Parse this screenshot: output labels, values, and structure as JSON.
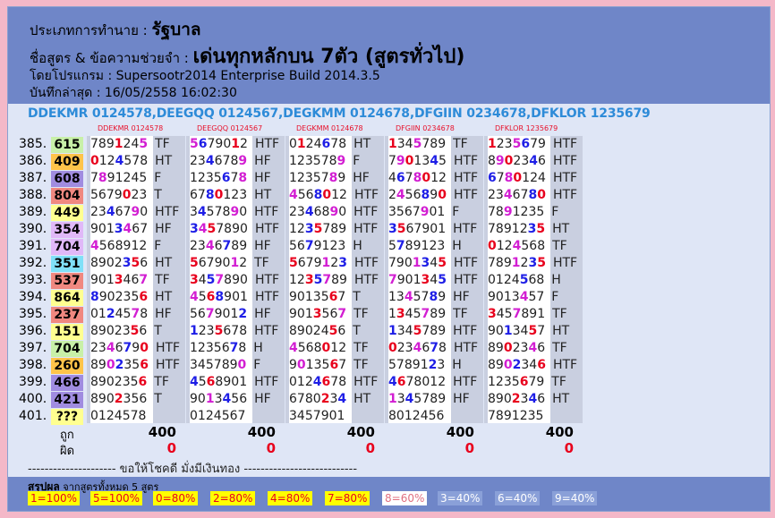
{
  "header": {
    "type_label": "ประเภทการทำนาย :",
    "type_value": "รัฐบาล",
    "formula_label": "ชื่อสูตร & ข้อความช่วยจำ :",
    "formula_value": "เด่นทุกหลักบน 7ตัว (สูตรทั่วไป)",
    "program": "โดยโปรแกรม : Supersootr2014 Enterprise Build 2014.3.5",
    "saved": "บันทึกล่าสุด : 16/05/2558 16:02:30"
  },
  "formula_line": "DDEKMR 0124578,DEEGQQ 0124567,DEGKMM 0124678,DFGIIN 0234678,DFKLOR 1235679",
  "columns": [
    "DDEKMR 0124578",
    "DEEGQQ 0124567",
    "DEGKMM 0124678",
    "DFGIIN 0234678",
    "DFKLOR 1235679"
  ],
  "colors": {
    "yellow": "#ffff90",
    "orange": "#ffc44a",
    "purple": "#a08ce0",
    "red": "#f08880",
    "cyan": "#80e0f8",
    "green": "#c8f0a8",
    "lightpurple": "#e0b8f8"
  },
  "rows": [
    {
      "num": "385.",
      "res": "615",
      "color": "green",
      "cells": [
        [
          "7891245",
          "TF"
        ],
        [
          "5679012",
          "HTF"
        ],
        [
          "0124678",
          "HT"
        ],
        [
          "1345789",
          "TF"
        ],
        [
          "1235679",
          "HTF"
        ]
      ]
    },
    {
      "num": "386.",
      "res": "409",
      "color": "orange",
      "cells": [
        [
          "0124578",
          "HT"
        ],
        [
          "2346789",
          "HF"
        ],
        [
          "1235789",
          "F"
        ],
        [
          "7901345",
          "HTF"
        ],
        [
          "8902346",
          "HTF"
        ]
      ]
    },
    {
      "num": "387.",
      "res": "608",
      "color": "purple",
      "cells": [
        [
          "7891245",
          "F"
        ],
        [
          "1235678",
          "HF"
        ],
        [
          "1235789",
          "HF"
        ],
        [
          "4678012",
          "HTF"
        ],
        [
          "6780124",
          "HTF"
        ]
      ]
    },
    {
      "num": "388.",
      "res": "804",
      "color": "red",
      "cells": [
        [
          "5679023",
          "T"
        ],
        [
          "6780123",
          "HT"
        ],
        [
          "4568012",
          "HTF"
        ],
        [
          "2456890",
          "HTF"
        ],
        [
          "2346780",
          "HTF"
        ]
      ]
    },
    {
      "num": "389.",
      "res": "449",
      "color": "yellow",
      "cells": [
        [
          "2346790",
          "HTF"
        ],
        [
          "3457890",
          "HTF"
        ],
        [
          "2346890",
          "HTF"
        ],
        [
          "3567901",
          "F"
        ],
        [
          "7891235",
          "F"
        ]
      ]
    },
    {
      "num": "390.",
      "res": "354",
      "color": "lightpurple",
      "cells": [
        [
          "9013467",
          "HF"
        ],
        [
          "3457890",
          "HTF"
        ],
        [
          "1235789",
          "HTF"
        ],
        [
          "3567901",
          "HTF"
        ],
        [
          "7891235",
          "HT"
        ]
      ]
    },
    {
      "num": "391.",
      "res": "704",
      "color": "lightpurple",
      "cells": [
        [
          "4568912",
          "F"
        ],
        [
          "2346789",
          "HF"
        ],
        [
          "5679123",
          "H"
        ],
        [
          "5789123",
          "H"
        ],
        [
          "0124568",
          "TF"
        ]
      ]
    },
    {
      "num": "392.",
      "res": "351",
      "color": "cyan",
      "cells": [
        [
          "8902356",
          "HT"
        ],
        [
          "5679012",
          "TF"
        ],
        [
          "5679123",
          "HTF"
        ],
        [
          "7901345",
          "HTF"
        ],
        [
          "7891235",
          "HTF"
        ]
      ]
    },
    {
      "num": "393.",
      "res": "537",
      "color": "red",
      "cells": [
        [
          "9013467",
          "TF"
        ],
        [
          "3457890",
          "HTF"
        ],
        [
          "1235789",
          "HTF"
        ],
        [
          "7901345",
          "HTF"
        ],
        [
          "0124568",
          "H"
        ]
      ]
    },
    {
      "num": "394.",
      "res": "864",
      "color": "yellow",
      "cells": [
        [
          "8902356",
          "HT"
        ],
        [
          "4568901",
          "HTF"
        ],
        [
          "9013567",
          "T"
        ],
        [
          "1345789",
          "HF"
        ],
        [
          "9013457",
          "F"
        ]
      ]
    },
    {
      "num": "395.",
      "res": "237",
      "color": "red",
      "cells": [
        [
          "0124578",
          "HF"
        ],
        [
          "5679012",
          "HF"
        ],
        [
          "9013567",
          "TF"
        ],
        [
          "1345789",
          "TF"
        ],
        [
          "3457891",
          "TF"
        ]
      ]
    },
    {
      "num": "396.",
      "res": "151",
      "color": "yellow",
      "cells": [
        [
          "8902356",
          "T"
        ],
        [
          "1235678",
          "HTF"
        ],
        [
          "8902456",
          "T"
        ],
        [
          "1345789",
          "HTF"
        ],
        [
          "9013457",
          "HT"
        ]
      ]
    },
    {
      "num": "397.",
      "res": "704",
      "color": "green",
      "cells": [
        [
          "2346790",
          "HTF"
        ],
        [
          "1235678",
          "H"
        ],
        [
          "4568012",
          "TF"
        ],
        [
          "0234678",
          "HTF"
        ],
        [
          "8902346",
          "TF"
        ]
      ]
    },
    {
      "num": "398.",
      "res": "260",
      "color": "orange",
      "cells": [
        [
          "8902356",
          "HTF"
        ],
        [
          "3457890",
          "F"
        ],
        [
          "9013567",
          "TF"
        ],
        [
          "5789123",
          "H"
        ],
        [
          "8902346",
          "HTF"
        ]
      ]
    },
    {
      "num": "399.",
      "res": "466",
      "color": "purple",
      "cells": [
        [
          "8902356",
          "TF"
        ],
        [
          "4568901",
          "HTF"
        ],
        [
          "0124678",
          "HTF"
        ],
        [
          "4678012",
          "HTF"
        ],
        [
          "1235679",
          "TF"
        ]
      ]
    },
    {
      "num": "400.",
      "res": "421",
      "color": "purple",
      "cells": [
        [
          "8902356",
          "T"
        ],
        [
          "9013456",
          "HF"
        ],
        [
          "6780234",
          "HT"
        ],
        [
          "1345789",
          "HF"
        ],
        [
          "8902346",
          "HT"
        ]
      ]
    },
    {
      "num": "401.",
      "res": "???",
      "color": "yellow",
      "cells": [
        [
          "0124578",
          ""
        ],
        [
          "0124567",
          ""
        ],
        [
          "3457901",
          ""
        ],
        [
          "8012456",
          ""
        ],
        [
          "7891235",
          ""
        ]
      ]
    }
  ],
  "totals": {
    "hit_label": "ถูก",
    "miss_label": "ผิด",
    "hits": [
      "400",
      "400",
      "400",
      "400",
      "400"
    ],
    "misses": [
      "0",
      "0",
      "0",
      "0",
      "0"
    ]
  },
  "footer_line": "--------------------- ขอให้โชคดี มั่งมีเงินทอง ---------------------------",
  "summary": {
    "title": "สรุปผล",
    "subtitle": "จากสูตรทั้งหมด 5 สูตร",
    "badges": [
      {
        "label": "1=100%",
        "bg": "#ffff00",
        "fg": "#e8001c"
      },
      {
        "label": "5=100%",
        "bg": "#ffff00",
        "fg": "#e8001c"
      },
      {
        "label": "0=80%",
        "bg": "#ffff00",
        "fg": "#e8001c"
      },
      {
        "label": "2=80%",
        "bg": "#ffff00",
        "fg": "#e8001c"
      },
      {
        "label": "4=80%",
        "bg": "#ffff00",
        "fg": "#e8001c"
      },
      {
        "label": "7=80%",
        "bg": "#ffff00",
        "fg": "#e8001c"
      },
      {
        "label": "8=60%",
        "bg": "#ffffff",
        "fg": "#e07080"
      },
      {
        "label": "3=40%",
        "bg": "#8aa0d8",
        "fg": "#ffffff"
      },
      {
        "label": "6=40%",
        "bg": "#8aa0d8",
        "fg": "#ffffff"
      },
      {
        "label": "9=40%",
        "bg": "#8aa0d8",
        "fg": "#ffffff"
      }
    ]
  }
}
